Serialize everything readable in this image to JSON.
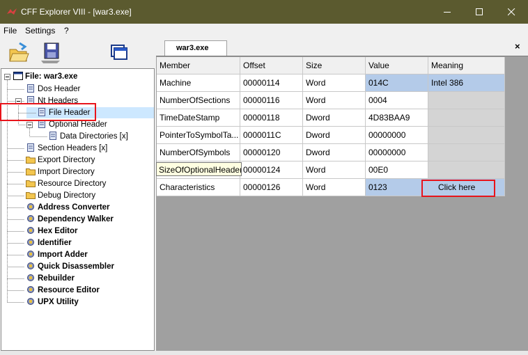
{
  "window": {
    "title": "CFF Explorer VIII - [war3.exe]",
    "colors": {
      "titlebar": "#5b5a2f",
      "selection": "#cde8ff",
      "highlight_box": "#e8141b",
      "value_cell": "#b4cbe9"
    }
  },
  "menu": {
    "items": [
      "File",
      "Settings",
      "?"
    ]
  },
  "toolbar": {
    "icons": [
      "open-file-icon",
      "save-disk-icon",
      "windows-icon"
    ]
  },
  "tree": {
    "items": [
      {
        "label": "File: war3.exe",
        "icon": "file-window-icon",
        "bold": true
      },
      {
        "label": "Dos Header",
        "icon": "page-icon"
      },
      {
        "label": "Nt Headers",
        "icon": "page-icon"
      },
      {
        "label": "File Header",
        "icon": "page-icon",
        "selected": true
      },
      {
        "label": "Optional Header",
        "icon": "page-icon"
      },
      {
        "label": "Data Directories [x]",
        "icon": "page-icon"
      },
      {
        "label": "Section Headers [x]",
        "icon": "page-icon"
      },
      {
        "label": "Export Directory",
        "icon": "folder-icon"
      },
      {
        "label": "Import Directory",
        "icon": "folder-icon"
      },
      {
        "label": "Resource Directory",
        "icon": "folder-icon"
      },
      {
        "label": "Debug Directory",
        "icon": "folder-icon"
      },
      {
        "label": "Address Converter",
        "icon": "tool-icon",
        "bold": true
      },
      {
        "label": "Dependency Walker",
        "icon": "tool-icon",
        "bold": true
      },
      {
        "label": "Hex Editor",
        "icon": "tool-icon",
        "bold": true
      },
      {
        "label": "Identifier",
        "icon": "tool-icon",
        "bold": true
      },
      {
        "label": "Import Adder",
        "icon": "tool-icon",
        "bold": true
      },
      {
        "label": "Quick Disassembler",
        "icon": "tool-icon",
        "bold": true
      },
      {
        "label": "Rebuilder",
        "icon": "tool-icon",
        "bold": true
      },
      {
        "label": "Resource Editor",
        "icon": "tool-icon",
        "bold": true
      },
      {
        "label": "UPX Utility",
        "icon": "tool-icon",
        "bold": true
      }
    ]
  },
  "tab": {
    "label": "war3.exe",
    "close": "×"
  },
  "table": {
    "columns": [
      "Member",
      "Offset",
      "Size",
      "Value",
      "Meaning"
    ],
    "rows": [
      {
        "member": "Machine",
        "offset": "00000114",
        "size": "Word",
        "value": "014C",
        "meaning": "Intel 386"
      },
      {
        "member": "NumberOfSections",
        "offset": "00000116",
        "size": "Word",
        "value": "0004",
        "meaning": ""
      },
      {
        "member": "TimeDateStamp",
        "offset": "00000118",
        "size": "Dword",
        "value": "4D83BAA9",
        "meaning": ""
      },
      {
        "member": "PointerToSymbolTa...",
        "offset": "0000011C",
        "size": "Dword",
        "value": "00000000",
        "meaning": ""
      },
      {
        "member": "NumberOfSymbols",
        "offset": "00000120",
        "size": "Dword",
        "value": "00000000",
        "meaning": ""
      },
      {
        "member": "SizeOfOptionalHea...",
        "offset": "00000124",
        "size": "Word",
        "value": "00E0",
        "meaning": ""
      },
      {
        "member": "Characteristics",
        "offset": "00000126",
        "size": "Word",
        "value": "0123",
        "meaning": "Click here"
      }
    ]
  },
  "tooltip": {
    "text": "SizeOfOptionalHeader"
  }
}
